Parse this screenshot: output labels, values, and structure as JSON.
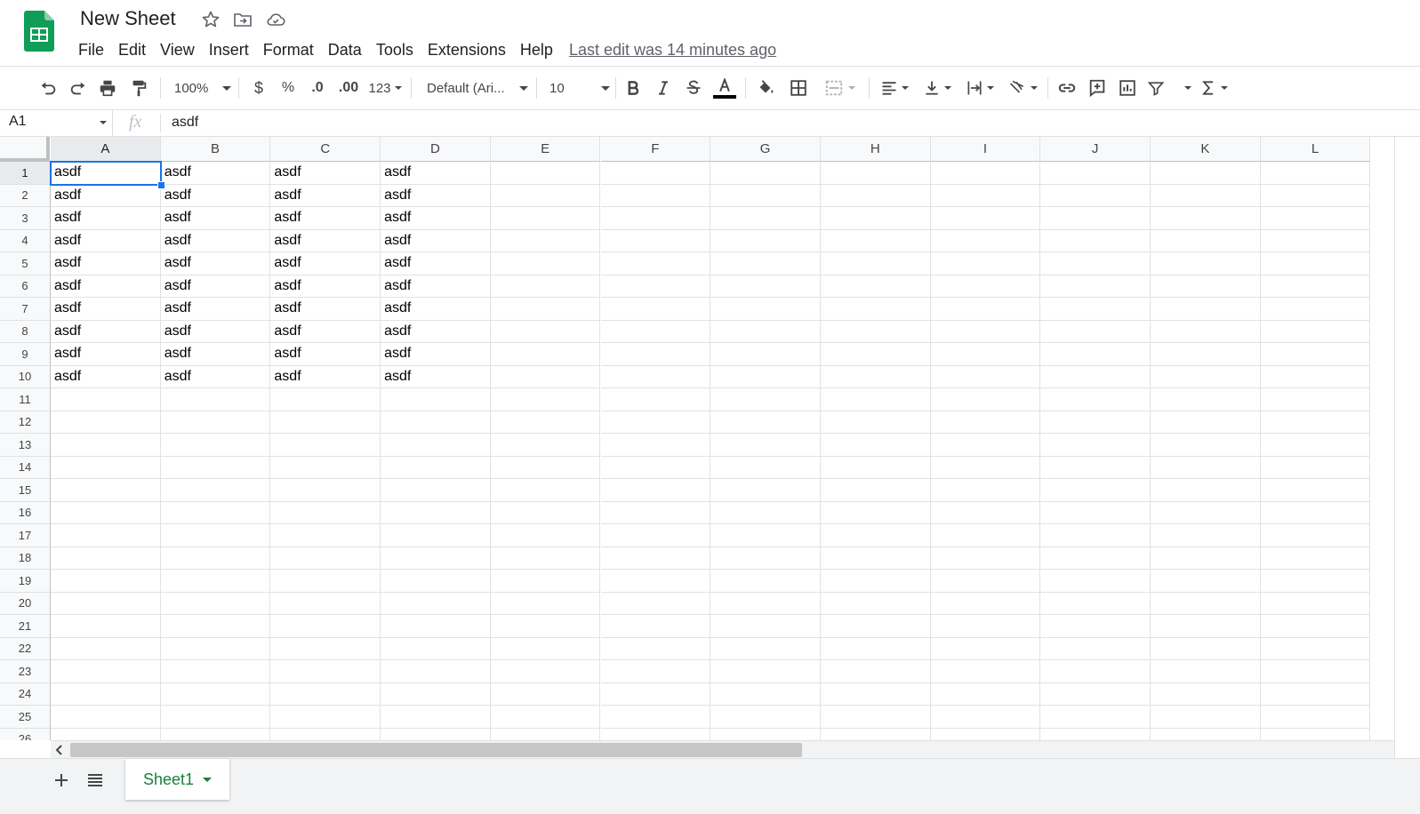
{
  "header": {
    "title": "New Sheet",
    "menus": [
      "File",
      "Edit",
      "View",
      "Insert",
      "Format",
      "Data",
      "Tools",
      "Extensions",
      "Help"
    ],
    "last_edit": "Last edit was 14 minutes ago"
  },
  "toolbar": {
    "zoom": "100%",
    "currency": "$",
    "percent": "%",
    "decrease_decimal": ".0",
    "increase_decimal": ".00",
    "more_formats": "123",
    "font": "Default (Ari...",
    "font_size": "10"
  },
  "formula_bar": {
    "name_box": "A1",
    "fx": "fx",
    "value": "asdf"
  },
  "grid": {
    "columns": [
      "A",
      "B",
      "C",
      "D",
      "E",
      "F",
      "G",
      "H",
      "I",
      "J",
      "K",
      "L"
    ],
    "row_count_visible": 26,
    "active_cell": "A1",
    "rows": [
      [
        "asdf",
        "asdf",
        "asdf",
        "asdf"
      ],
      [
        "asdf",
        "asdf",
        "asdf",
        "asdf"
      ],
      [
        "asdf",
        "asdf",
        "asdf",
        "asdf"
      ],
      [
        "asdf",
        "asdf",
        "asdf",
        "asdf"
      ],
      [
        "asdf",
        "asdf",
        "asdf",
        "asdf"
      ],
      [
        "asdf",
        "asdf",
        "asdf",
        "asdf"
      ],
      [
        "asdf",
        "asdf",
        "asdf",
        "asdf"
      ],
      [
        "asdf",
        "asdf",
        "asdf",
        "asdf"
      ],
      [
        "asdf",
        "asdf",
        "asdf",
        "asdf"
      ],
      [
        "asdf",
        "asdf",
        "asdf",
        "asdf"
      ]
    ]
  },
  "sheets": {
    "tabs": [
      "Sheet1"
    ],
    "active": "Sheet1"
  },
  "colors": {
    "accent": "#1a73e8",
    "sheet_green": "#188038",
    "logo_green": "#0f9d58"
  }
}
